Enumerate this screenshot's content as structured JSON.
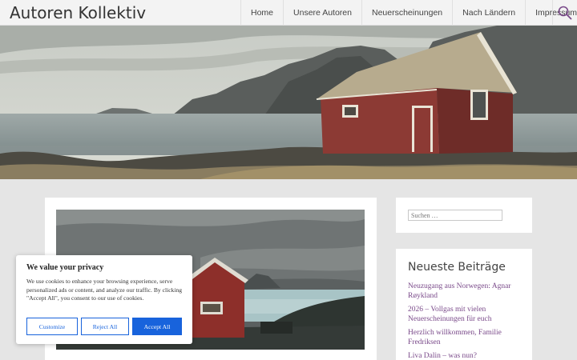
{
  "site": {
    "title": "Autoren Kollektiv"
  },
  "nav": {
    "items": [
      {
        "label": "Home"
      },
      {
        "label": "Unsere Autoren"
      },
      {
        "label": "Neuerscheinungen"
      },
      {
        "label": "Nach Ländern"
      },
      {
        "label": "Impressum"
      }
    ],
    "search_icon": "search-icon"
  },
  "sidebar": {
    "search": {
      "placeholder": "Suchen …"
    },
    "recent": {
      "title": "Neueste Beiträge",
      "items": [
        {
          "label": "Neuzugang aus Norwegen: Agnar Røykland"
        },
        {
          "label": "2026 – Vollgas mit vielen Neuerscheinungen für euch"
        },
        {
          "label": "Herzlich willkommen, Familie Fredriksen"
        },
        {
          "label": "Liva Dalin – was nun?"
        }
      ]
    }
  },
  "cookie": {
    "title": "We value your privacy",
    "text": "We use cookies to enhance your browsing experience, serve personalized ads or content, and analyze our traffic. By clicking \"Accept All\", you consent to our use of cookies.",
    "customize": "Customize",
    "reject": "Reject All",
    "accept": "Accept All"
  },
  "colors": {
    "link": "#7a4a8a",
    "accent": "#1863dc",
    "page_bg": "#e5e5e5"
  }
}
